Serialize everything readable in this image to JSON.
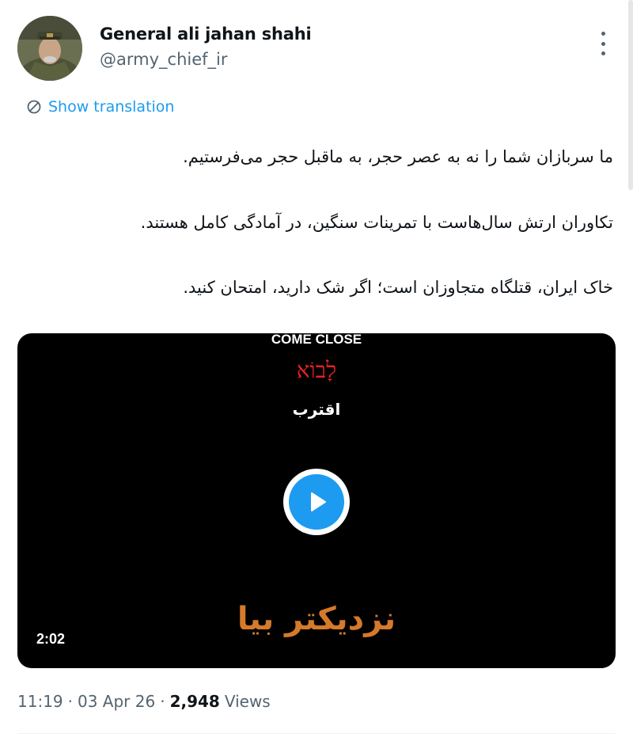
{
  "author": {
    "display_name": "General ali jahan shahi",
    "handle": "@army_chief_ir"
  },
  "translation": {
    "label": "Show translation"
  },
  "tweet": {
    "paragraphs": [
      "ما سربازان شما را نه به عصر حجر، به ماقبل حجر می‌فرستیم.",
      "تکاوران ارتش سال‌هاست با تمرینات سنگین، در آمادگی کامل هستند.",
      "خاک ایران، قتلگاه متجاوزان است؛ اگر شک دارید، امتحان کنید."
    ]
  },
  "media": {
    "caption_en": "COME CLOSE",
    "caption_he": "לָבוֹא",
    "caption_ar": "اقترب",
    "title_fa": "نزدیکتر بیا",
    "duration": "2:02",
    "play_icon": "play-icon",
    "colors": {
      "background": "#000000",
      "play_button": "#1d9bf0",
      "hebrew_caption": "#e02424",
      "title": "#d47a2a"
    }
  },
  "meta": {
    "time": "11:19",
    "date": "03 Apr 26",
    "views_count": "2,948",
    "views_label": "Views"
  },
  "icons": {
    "more": "more-options-icon",
    "translate": "translate-icon"
  },
  "colors": {
    "accent": "#1d9bf0",
    "text_primary": "#0f1419",
    "text_secondary": "#536471"
  }
}
